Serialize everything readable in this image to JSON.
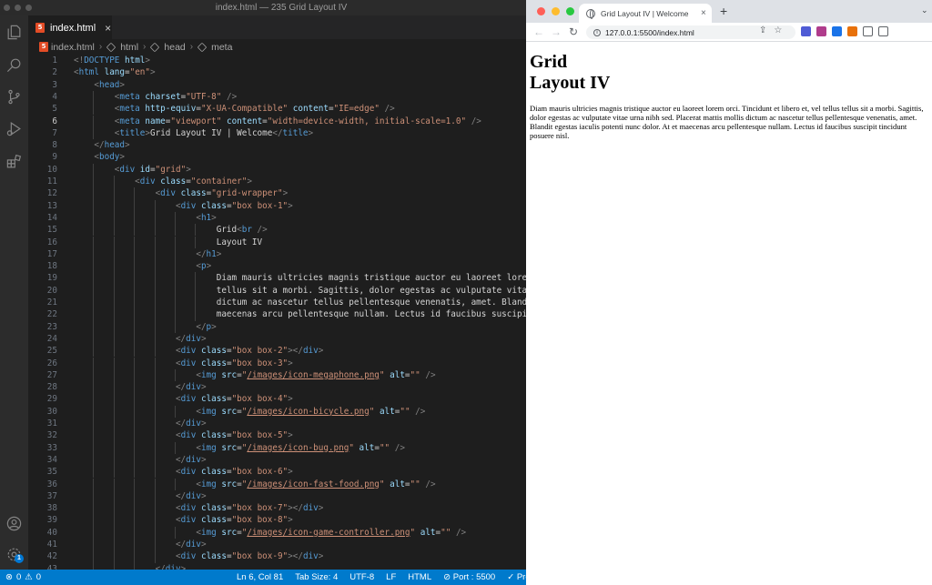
{
  "vscode": {
    "window_title": "index.html — 235 Grid Layout IV",
    "tab": {
      "label": "index.html",
      "close": "×"
    },
    "breadcrumb": [
      "index.html",
      "html",
      "head",
      "meta"
    ],
    "active_line": 6,
    "lines": [
      [
        [
          "br",
          "<!"
        ],
        [
          "tag",
          "DOCTYPE"
        ],
        [
          "txt",
          " "
        ],
        [
          "attr",
          "html"
        ],
        [
          "br",
          ">"
        ]
      ],
      [
        [
          "br",
          "<"
        ],
        [
          "tag",
          "html"
        ],
        [
          "txt",
          " "
        ],
        [
          "attr",
          "lang"
        ],
        [
          "txt",
          "="
        ],
        [
          "str",
          "\"en\""
        ],
        [
          "br",
          ">"
        ]
      ],
      [
        [
          "txt",
          "    "
        ],
        [
          "br",
          "<"
        ],
        [
          "tag",
          "head"
        ],
        [
          "br",
          ">"
        ]
      ],
      [
        [
          "txt",
          "        "
        ],
        [
          "br",
          "<"
        ],
        [
          "tag",
          "meta"
        ],
        [
          "txt",
          " "
        ],
        [
          "attr",
          "charset"
        ],
        [
          "txt",
          "="
        ],
        [
          "str",
          "\"UTF-8\""
        ],
        [
          "txt",
          " "
        ],
        [
          "br",
          "/>"
        ]
      ],
      [
        [
          "txt",
          "        "
        ],
        [
          "br",
          "<"
        ],
        [
          "tag",
          "meta"
        ],
        [
          "txt",
          " "
        ],
        [
          "attr",
          "http-equiv"
        ],
        [
          "txt",
          "="
        ],
        [
          "str",
          "\"X-UA-Compatible\""
        ],
        [
          "txt",
          " "
        ],
        [
          "attr",
          "content"
        ],
        [
          "txt",
          "="
        ],
        [
          "str",
          "\"IE=edge\""
        ],
        [
          "txt",
          " "
        ],
        [
          "br",
          "/>"
        ]
      ],
      [
        [
          "txt",
          "        "
        ],
        [
          "br",
          "<"
        ],
        [
          "tag",
          "meta"
        ],
        [
          "txt",
          " "
        ],
        [
          "attr",
          "name"
        ],
        [
          "txt",
          "="
        ],
        [
          "str",
          "\"viewport\""
        ],
        [
          "txt",
          " "
        ],
        [
          "attr",
          "content"
        ],
        [
          "txt",
          "="
        ],
        [
          "str",
          "\"width=device-width, initial-scale=1.0\""
        ],
        [
          "txt",
          " "
        ],
        [
          "br",
          "/>"
        ]
      ],
      [
        [
          "txt",
          "        "
        ],
        [
          "br",
          "<"
        ],
        [
          "tag",
          "title"
        ],
        [
          "br",
          ">"
        ],
        [
          "txt",
          "Grid Layout IV | Welcome"
        ],
        [
          "br",
          "</"
        ],
        [
          "tag",
          "title"
        ],
        [
          "br",
          ">"
        ]
      ],
      [
        [
          "txt",
          "    "
        ],
        [
          "br",
          "</"
        ],
        [
          "tag",
          "head"
        ],
        [
          "br",
          ">"
        ]
      ],
      [
        [
          "txt",
          "    "
        ],
        [
          "br",
          "<"
        ],
        [
          "tag",
          "body"
        ],
        [
          "br",
          ">"
        ]
      ],
      [
        [
          "txt",
          "        "
        ],
        [
          "br",
          "<"
        ],
        [
          "tag",
          "div"
        ],
        [
          "txt",
          " "
        ],
        [
          "attr",
          "id"
        ],
        [
          "txt",
          "="
        ],
        [
          "str",
          "\"grid\""
        ],
        [
          "br",
          ">"
        ]
      ],
      [
        [
          "txt",
          "            "
        ],
        [
          "br",
          "<"
        ],
        [
          "tag",
          "div"
        ],
        [
          "txt",
          " "
        ],
        [
          "attr",
          "class"
        ],
        [
          "txt",
          "="
        ],
        [
          "str",
          "\"container\""
        ],
        [
          "br",
          ">"
        ]
      ],
      [
        [
          "txt",
          "                "
        ],
        [
          "br",
          "<"
        ],
        [
          "tag",
          "div"
        ],
        [
          "txt",
          " "
        ],
        [
          "attr",
          "class"
        ],
        [
          "txt",
          "="
        ],
        [
          "str",
          "\"grid-wrapper\""
        ],
        [
          "br",
          ">"
        ]
      ],
      [
        [
          "txt",
          "                    "
        ],
        [
          "br",
          "<"
        ],
        [
          "tag",
          "div"
        ],
        [
          "txt",
          " "
        ],
        [
          "attr",
          "class"
        ],
        [
          "txt",
          "="
        ],
        [
          "str",
          "\"box box-1\""
        ],
        [
          "br",
          ">"
        ]
      ],
      [
        [
          "txt",
          "                        "
        ],
        [
          "br",
          "<"
        ],
        [
          "tag",
          "h1"
        ],
        [
          "br",
          ">"
        ]
      ],
      [
        [
          "txt",
          "                            Grid"
        ],
        [
          "br",
          "<"
        ],
        [
          "tag",
          "br"
        ],
        [
          "txt",
          " "
        ],
        [
          "br",
          "/>"
        ]
      ],
      [
        [
          "txt",
          "                            Layout IV"
        ]
      ],
      [
        [
          "txt",
          "                        "
        ],
        [
          "br",
          "</"
        ],
        [
          "tag",
          "h1"
        ],
        [
          "br",
          ">"
        ]
      ],
      [
        [
          "txt",
          "                        "
        ],
        [
          "br",
          "<"
        ],
        [
          "tag",
          "p"
        ],
        [
          "br",
          ">"
        ]
      ],
      [
        [
          "txt",
          "                            Diam mauris ultricies magnis tristique auctor eu laoreet lorem or"
        ]
      ],
      [
        [
          "txt",
          "                            tellus sit a morbi. Sagittis, dolor egestas ac vulputate vitae ur"
        ]
      ],
      [
        [
          "txt",
          "                            dictum ac nascetur tellus pellentesque venenatis, amet. Blandit e"
        ]
      ],
      [
        [
          "txt",
          "                            maecenas arcu pellentesque nullam. Lectus id faucibus suscipit ti"
        ]
      ],
      [
        [
          "txt",
          "                        "
        ],
        [
          "br",
          "</"
        ],
        [
          "tag",
          "p"
        ],
        [
          "br",
          ">"
        ]
      ],
      [
        [
          "txt",
          "                    "
        ],
        [
          "br",
          "</"
        ],
        [
          "tag",
          "div"
        ],
        [
          "br",
          ">"
        ]
      ],
      [
        [
          "txt",
          "                    "
        ],
        [
          "br",
          "<"
        ],
        [
          "tag",
          "div"
        ],
        [
          "txt",
          " "
        ],
        [
          "attr",
          "class"
        ],
        [
          "txt",
          "="
        ],
        [
          "str",
          "\"box box-2\""
        ],
        [
          "br",
          "></"
        ],
        [
          "tag",
          "div"
        ],
        [
          "br",
          ">"
        ]
      ],
      [
        [
          "txt",
          "                    "
        ],
        [
          "br",
          "<"
        ],
        [
          "tag",
          "div"
        ],
        [
          "txt",
          " "
        ],
        [
          "attr",
          "class"
        ],
        [
          "txt",
          "="
        ],
        [
          "str",
          "\"box box-3\""
        ],
        [
          "br",
          ">"
        ]
      ],
      [
        [
          "txt",
          "                        "
        ],
        [
          "br",
          "<"
        ],
        [
          "tag",
          "img"
        ],
        [
          "txt",
          " "
        ],
        [
          "attr",
          "src"
        ],
        [
          "txt",
          "="
        ],
        [
          "str",
          "\""
        ],
        [
          "link",
          "/images/icon-megaphone.png"
        ],
        [
          "str",
          "\""
        ],
        [
          "txt",
          " "
        ],
        [
          "attr",
          "alt"
        ],
        [
          "txt",
          "="
        ],
        [
          "str",
          "\"\""
        ],
        [
          "txt",
          " "
        ],
        [
          "br",
          "/>"
        ]
      ],
      [
        [
          "txt",
          "                    "
        ],
        [
          "br",
          "</"
        ],
        [
          "tag",
          "div"
        ],
        [
          "br",
          ">"
        ]
      ],
      [
        [
          "txt",
          "                    "
        ],
        [
          "br",
          "<"
        ],
        [
          "tag",
          "div"
        ],
        [
          "txt",
          " "
        ],
        [
          "attr",
          "class"
        ],
        [
          "txt",
          "="
        ],
        [
          "str",
          "\"box box-4\""
        ],
        [
          "br",
          ">"
        ]
      ],
      [
        [
          "txt",
          "                        "
        ],
        [
          "br",
          "<"
        ],
        [
          "tag",
          "img"
        ],
        [
          "txt",
          " "
        ],
        [
          "attr",
          "src"
        ],
        [
          "txt",
          "="
        ],
        [
          "str",
          "\""
        ],
        [
          "link",
          "/images/icon-bicycle.png"
        ],
        [
          "str",
          "\""
        ],
        [
          "txt",
          " "
        ],
        [
          "attr",
          "alt"
        ],
        [
          "txt",
          "="
        ],
        [
          "str",
          "\"\""
        ],
        [
          "txt",
          " "
        ],
        [
          "br",
          "/>"
        ]
      ],
      [
        [
          "txt",
          "                    "
        ],
        [
          "br",
          "</"
        ],
        [
          "tag",
          "div"
        ],
        [
          "br",
          ">"
        ]
      ],
      [
        [
          "txt",
          "                    "
        ],
        [
          "br",
          "<"
        ],
        [
          "tag",
          "div"
        ],
        [
          "txt",
          " "
        ],
        [
          "attr",
          "class"
        ],
        [
          "txt",
          "="
        ],
        [
          "str",
          "\"box box-5\""
        ],
        [
          "br",
          ">"
        ]
      ],
      [
        [
          "txt",
          "                        "
        ],
        [
          "br",
          "<"
        ],
        [
          "tag",
          "img"
        ],
        [
          "txt",
          " "
        ],
        [
          "attr",
          "src"
        ],
        [
          "txt",
          "="
        ],
        [
          "str",
          "\""
        ],
        [
          "link",
          "/images/icon-bug.png"
        ],
        [
          "str",
          "\""
        ],
        [
          "txt",
          " "
        ],
        [
          "attr",
          "alt"
        ],
        [
          "txt",
          "="
        ],
        [
          "str",
          "\"\""
        ],
        [
          "txt",
          " "
        ],
        [
          "br",
          "/>"
        ]
      ],
      [
        [
          "txt",
          "                    "
        ],
        [
          "br",
          "</"
        ],
        [
          "tag",
          "div"
        ],
        [
          "br",
          ">"
        ]
      ],
      [
        [
          "txt",
          "                    "
        ],
        [
          "br",
          "<"
        ],
        [
          "tag",
          "div"
        ],
        [
          "txt",
          " "
        ],
        [
          "attr",
          "class"
        ],
        [
          "txt",
          "="
        ],
        [
          "str",
          "\"box box-6\""
        ],
        [
          "br",
          ">"
        ]
      ],
      [
        [
          "txt",
          "                        "
        ],
        [
          "br",
          "<"
        ],
        [
          "tag",
          "img"
        ],
        [
          "txt",
          " "
        ],
        [
          "attr",
          "src"
        ],
        [
          "txt",
          "="
        ],
        [
          "str",
          "\""
        ],
        [
          "link",
          "/images/icon-fast-food.png"
        ],
        [
          "str",
          "\""
        ],
        [
          "txt",
          " "
        ],
        [
          "attr",
          "alt"
        ],
        [
          "txt",
          "="
        ],
        [
          "str",
          "\"\""
        ],
        [
          "txt",
          " "
        ],
        [
          "br",
          "/>"
        ]
      ],
      [
        [
          "txt",
          "                    "
        ],
        [
          "br",
          "</"
        ],
        [
          "tag",
          "div"
        ],
        [
          "br",
          ">"
        ]
      ],
      [
        [
          "txt",
          "                    "
        ],
        [
          "br",
          "<"
        ],
        [
          "tag",
          "div"
        ],
        [
          "txt",
          " "
        ],
        [
          "attr",
          "class"
        ],
        [
          "txt",
          "="
        ],
        [
          "str",
          "\"box box-7\""
        ],
        [
          "br",
          "></"
        ],
        [
          "tag",
          "div"
        ],
        [
          "br",
          ">"
        ]
      ],
      [
        [
          "txt",
          "                    "
        ],
        [
          "br",
          "<"
        ],
        [
          "tag",
          "div"
        ],
        [
          "txt",
          " "
        ],
        [
          "attr",
          "class"
        ],
        [
          "txt",
          "="
        ],
        [
          "str",
          "\"box box-8\""
        ],
        [
          "br",
          ">"
        ]
      ],
      [
        [
          "txt",
          "                        "
        ],
        [
          "br",
          "<"
        ],
        [
          "tag",
          "img"
        ],
        [
          "txt",
          " "
        ],
        [
          "attr",
          "src"
        ],
        [
          "txt",
          "="
        ],
        [
          "str",
          "\""
        ],
        [
          "link",
          "/images/icon-game-controller.png"
        ],
        [
          "str",
          "\""
        ],
        [
          "txt",
          " "
        ],
        [
          "attr",
          "alt"
        ],
        [
          "txt",
          "="
        ],
        [
          "str",
          "\"\""
        ],
        [
          "txt",
          " "
        ],
        [
          "br",
          "/>"
        ]
      ],
      [
        [
          "txt",
          "                    "
        ],
        [
          "br",
          "</"
        ],
        [
          "tag",
          "div"
        ],
        [
          "br",
          ">"
        ]
      ],
      [
        [
          "txt",
          "                    "
        ],
        [
          "br",
          "<"
        ],
        [
          "tag",
          "div"
        ],
        [
          "txt",
          " "
        ],
        [
          "attr",
          "class"
        ],
        [
          "txt",
          "="
        ],
        [
          "str",
          "\"box box-9\""
        ],
        [
          "br",
          "></"
        ],
        [
          "tag",
          "div"
        ],
        [
          "br",
          ">"
        ]
      ],
      [
        [
          "txt",
          "                "
        ],
        [
          "br",
          "</"
        ],
        [
          "tag",
          "div"
        ],
        [
          "br",
          ">"
        ]
      ]
    ],
    "activity_badge": "1",
    "status": {
      "errors": "0",
      "warnings": "0",
      "position": "Ln 6, Col 81",
      "tab_size": "Tab Size: 4",
      "encoding": "UTF-8",
      "eol": "LF",
      "language": "HTML",
      "port": "Port : 5500",
      "prettier": "Pret"
    }
  },
  "browser": {
    "tab_title": "Grid Layout IV | Welcome",
    "tab_close": "×",
    "new_tab": "+",
    "url": "127.0.0.1:5500/index.html",
    "page": {
      "heading_line1": "Grid",
      "heading_line2": "Layout IV",
      "paragraph": "Diam mauris ultricies magnis tristique auctor eu laoreet lorem orci. Tincidunt et libero et, vel tellus tellus sit a morbi. Sagittis, dolor egestas ac vulputate vitae urna nibh sed. Placerat mattis mollis dictum ac nascetur tellus pellentesque venenatis, amet. Blandit egestas iaculis potenti nunc dolor. At et maecenas arcu pellentesque nullam. Lectus id faucibus suscipit tincidunt posuere nisl."
    },
    "extension_colors": [
      "#4f5bd5",
      "#b03c8c",
      "#1a73e8",
      "#e8710a",
      "#5f6368",
      "#5f6368"
    ]
  }
}
